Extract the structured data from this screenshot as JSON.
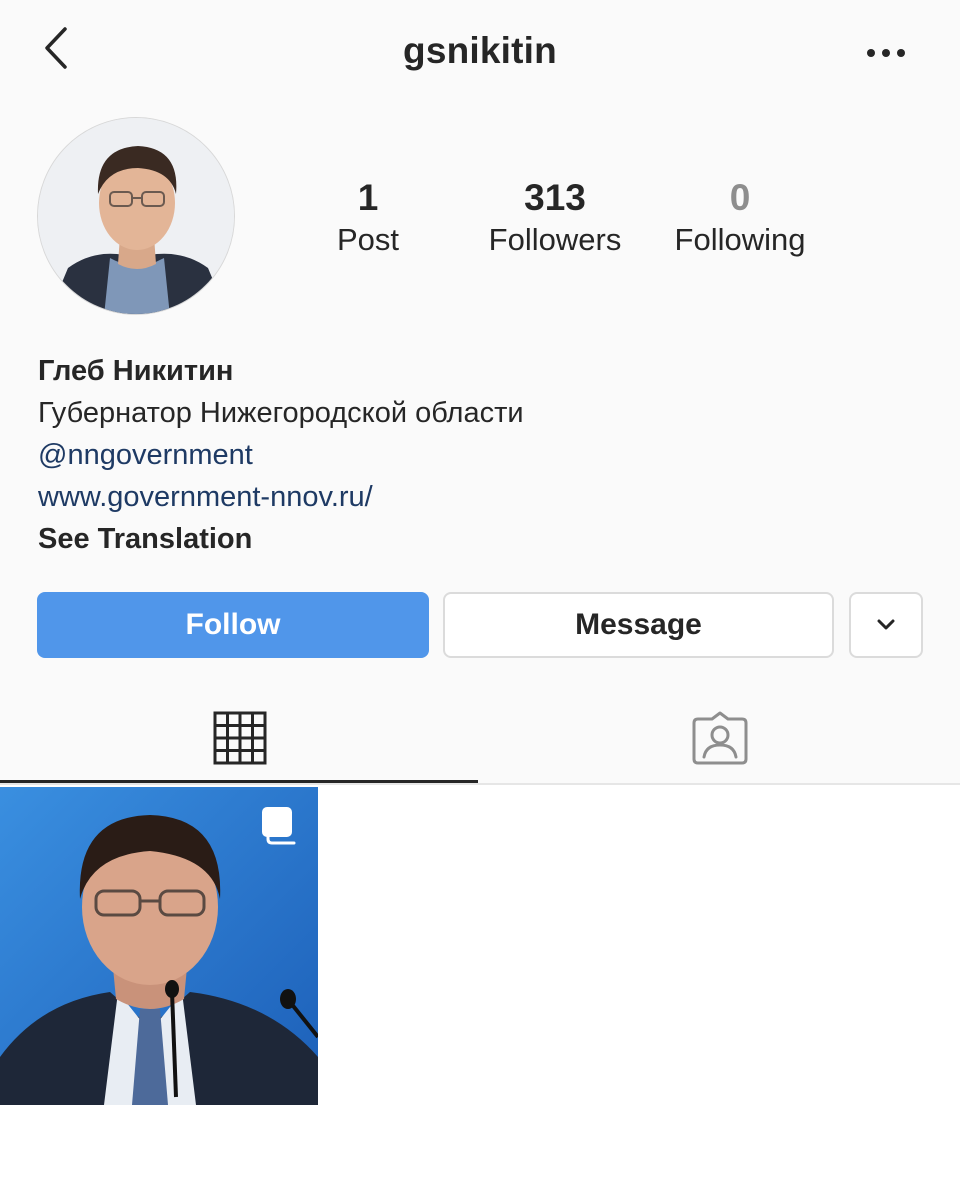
{
  "header": {
    "username": "gsnikitin",
    "back_icon": "chevron-left-icon",
    "more_icon": "more-horizontal-icon"
  },
  "profile": {
    "avatar_icon": "profile-photo",
    "stats": {
      "posts": {
        "value": "1",
        "label": "Post"
      },
      "followers": {
        "value": "313",
        "label": "Followers"
      },
      "following": {
        "value": "0",
        "label": "Following"
      }
    },
    "bio": {
      "name": "Глеб Никитин",
      "description": "Губернатор Нижегородской области",
      "mention": "@nngovernment",
      "website": "www.government-nnov.ru/",
      "see_translation": "See Translation"
    }
  },
  "actions": {
    "follow_label": "Follow",
    "message_label": "Message",
    "more_icon": "chevron-down-icon"
  },
  "tabs": {
    "grid_icon": "grid-icon",
    "tagged_icon": "tagged-person-icon"
  },
  "posts": [
    {
      "type": "carousel",
      "icon": "carousel-icon"
    }
  ],
  "colors": {
    "follow_button": "#5096ea",
    "link": "#1e3a64",
    "background": "#fafafa",
    "text": "#262626"
  }
}
